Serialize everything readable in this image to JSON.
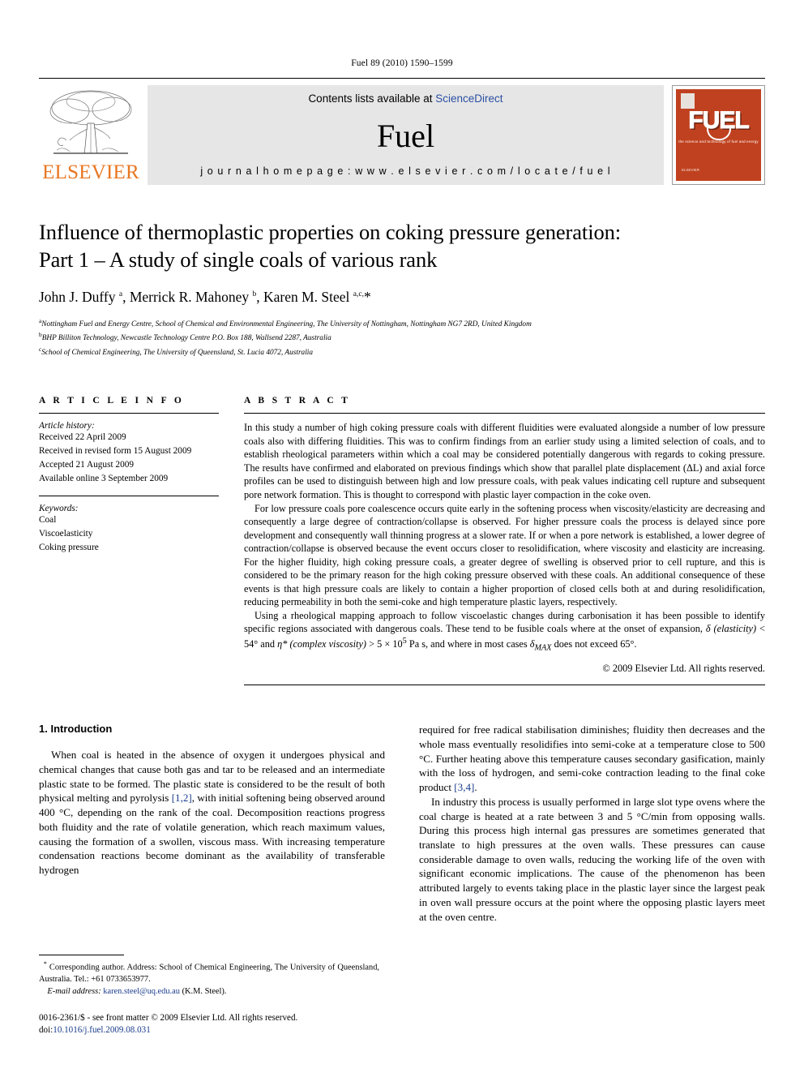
{
  "running_head": "Fuel 89 (2010) 1590–1599",
  "masthead": {
    "publisher_name": "ELSEVIER",
    "contents_prefix": "Contents lists available at ",
    "contents_link": "ScienceDirect",
    "journal_name": "Fuel",
    "homepage": "j o u r n a l   h o m e p a g e :   w w w . e l s e v i e r . c o m / l o c a t e / f u e l",
    "cover_title": "FUEL",
    "cover_subtitle": "the science and technology of fuel and energy",
    "cover_footer": "ELSEVIER",
    "brand_orange": "#E87722",
    "cover_red": "#C0411F",
    "link_blue": "#2b4fa2"
  },
  "article": {
    "title_line1": "Influence of thermoplastic properties on coking pressure generation:",
    "title_line2": "Part 1 – A study of single coals of various rank",
    "authors_html": "John J. Duffy <sup>a</sup>, Merrick R. Mahoney <sup>b</sup>, Karen M. Steel <sup>a,c,</sup>*",
    "affiliations": [
      "Nottingham Fuel and Energy Centre, School of Chemical and Environmental Engineering, The University of Nottingham, Nottingham NG7 2RD, United Kingdom",
      "BHP Billiton Technology, Newcastle Technology Centre P.O. Box 188, Wallsend 2287, Australia",
      "School of Chemical Engineering, The University of Queensland, St. Lucia 4072, Australia"
    ],
    "affiliation_marks": [
      "a",
      "b",
      "c"
    ]
  },
  "info": {
    "heading": "A R T I C L E   I N F O",
    "history_label": "Article history:",
    "history": [
      "Received 22 April 2009",
      "Received in revised form 15 August 2009",
      "Accepted 21 August 2009",
      "Available online 3 September 2009"
    ],
    "keywords_label": "Keywords:",
    "keywords": [
      "Coal",
      "Viscoelasticity",
      "Coking pressure"
    ]
  },
  "abstract": {
    "heading": "A B S T R A C T",
    "paragraphs": [
      "In this study a number of high coking pressure coals with different fluidities were evaluated alongside a number of low pressure coals also with differing fluidities. This was to confirm findings from an earlier study using a limited selection of coals, and to establish rheological parameters within which a coal may be considered potentially dangerous with regards to coking pressure. The results have confirmed and elaborated on previous findings which show that parallel plate displacement (ΔL) and axial force profiles can be used to distinguish between high and low pressure coals, with peak values indicating cell rupture and subsequent pore network formation. This is thought to correspond with plastic layer compaction in the coke oven.",
      "For low pressure coals pore coalescence occurs quite early in the softening process when viscosity/elasticity are decreasing and consequently a large degree of contraction/collapse is observed. For higher pressure coals the process is delayed since pore development and consequently wall thinning progress at a slower rate. If or when a pore network is established, a lower degree of contraction/collapse is observed because the event occurs closer to resolidification, where viscosity and elasticity are increasing. For the higher fluidity, high coking pressure coals, a greater degree of swelling is observed prior to cell rupture, and this is considered to be the primary reason for the high coking pressure observed with these coals. An additional consequence of these events is that high pressure coals are likely to contain a higher proportion of closed cells both at and during resolidification, reducing permeability in both the semi-coke and high temperature plastic layers, respectively."
    ],
    "final_paragraph_html": "Using a rheological mapping approach to follow viscoelastic changes during carbonisation it has been possible to identify specific regions associated with dangerous coals. These tend to be fusible coals where at the onset of expansion, <i>δ (elasticity)</i> &lt; 54° and <i>η* (complex viscosity)</i> &gt; 5 × 10<sup>5</sup> Pa s, and where in most cases <i>δ<sub>MAX</sub></i> does not exceed 65°.",
    "copyright": "© 2009 Elsevier Ltd. All rights reserved."
  },
  "introduction": {
    "heading": "1. Introduction",
    "left_p1": "When coal is heated in the absence of oxygen it undergoes physical and chemical changes that cause both gas and tar to be released and an intermediate plastic state to be formed. The plastic state is considered to be the result of both physical melting and pyrolysis [1,2], with initial softening being observed around 400 °C, depending on the rank of the coal. Decomposition reactions progress both fluidity and the rate of volatile generation, which reach maximum values, causing the formation of a swollen, viscous mass. With increasing temperature condensation reactions become dominant as the availability of transferable hydrogen",
    "left_ref": "[1,2]",
    "right_p1": "required for free radical stabilisation diminishes; fluidity then decreases and the whole mass eventually resolidifies into semi-coke at a temperature close to 500 °C. Further heating above this temperature causes secondary gasification, mainly with the loss of hydrogen, and semi-coke contraction leading to the final coke product [3,4].",
    "right_ref": "[3,4]",
    "right_p2": "In industry this process is usually performed in large slot type ovens where the coal charge is heated at a rate between 3 and 5 °C/min from opposing walls. During this process high internal gas pressures are sometimes generated that translate to high pressures at the oven walls. These pressures can cause considerable damage to oven walls, reducing the working life of the oven with significant economic implications. The cause of the phenomenon has been attributed largely to events taking place in the plastic layer since the largest peak in oven wall pressure occurs at the point where the opposing plastic layers meet at the oven centre."
  },
  "footnotes": {
    "corresponding_marker": "*",
    "corresponding": "Corresponding author. Address: School of Chemical Engineering, The University of Queensland, Australia. Tel.: +61 0733653977.",
    "email_label": "E-mail address:",
    "email": "karen.steel@uq.edu.au",
    "email_owner": "(K.M. Steel).",
    "issn_line": "0016-2361/$ - see front matter © 2009 Elsevier Ltd. All rights reserved.",
    "doi_label": "doi:",
    "doi": "10.1016/j.fuel.2009.08.031"
  }
}
